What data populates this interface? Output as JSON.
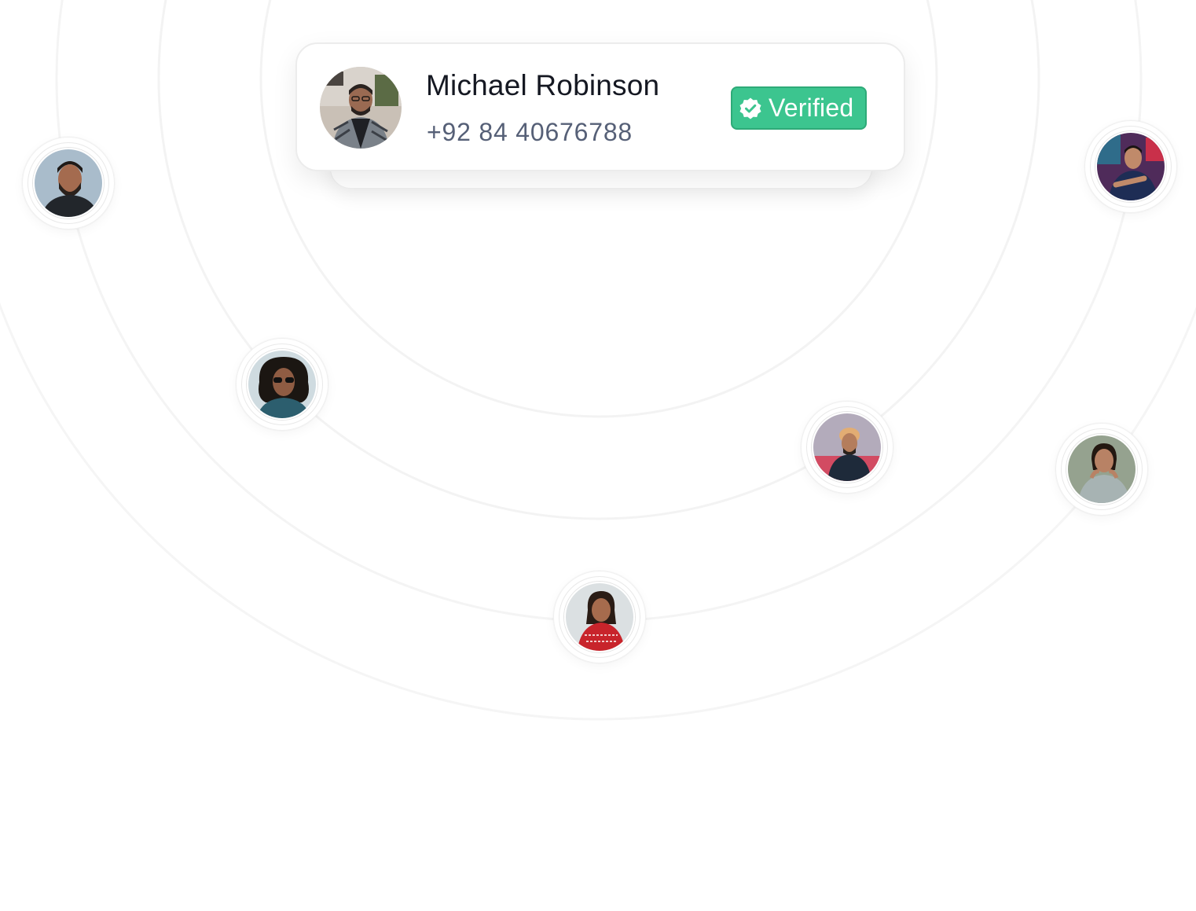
{
  "profile_card": {
    "name": "Michael Robinson",
    "phone": "+92 84 40676788",
    "badge_label": "Verified",
    "badge_icon": "verified-check-icon",
    "badge_color": "#3cc58f"
  },
  "contacts": [
    {
      "id": "contact-1",
      "description": "man-with-beard-avatar",
      "bg": "#9fb3c4",
      "skin": "#a46b4f",
      "hair": "#1f1a17",
      "shirt": "#22262b"
    },
    {
      "id": "contact-2",
      "description": "man-curly-hair-sunglasses-avatar",
      "bg": "#c9d6dc",
      "skin": "#8f5c43",
      "hair": "#1b1612",
      "shirt": "#2c5e6e"
    },
    {
      "id": "contact-3",
      "description": "woman-red-sweater-avatar",
      "bg": "#d8dde0",
      "skin": "#a66b4d",
      "hair": "#2a1c15",
      "shirt": "#c8242b"
    },
    {
      "id": "contact-4",
      "description": "man-turban-leather-jacket-avatar",
      "bg": "#b0a9b8",
      "skin": "#b47d5c",
      "hair": "#e2ad73",
      "shirt": "#1e2a3a"
    },
    {
      "id": "contact-5",
      "description": "woman-grey-sweater-avatar",
      "bg": "#8e9a88",
      "skin": "#b88265",
      "hair": "#241811",
      "shirt": "#a7b3b3"
    },
    {
      "id": "contact-6",
      "description": "man-navy-shirt-avatar",
      "bg": "#4f2b5a",
      "skin": "#c08a6a",
      "hair": "#1a1413",
      "shirt": "#1e2d55"
    }
  ]
}
